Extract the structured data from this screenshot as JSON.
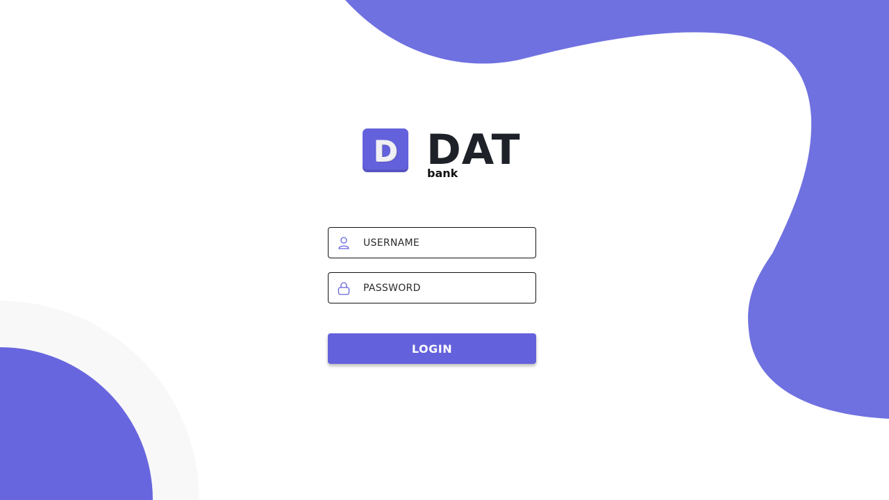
{
  "theme": {
    "accent": "#6461dc",
    "blob": "#6f71e0",
    "ring": "#f8f8f8",
    "text_dark": "#1f2128"
  },
  "logo": {
    "mark_letter": "D",
    "wordmark": "DAT",
    "subtitle": "bank"
  },
  "form": {
    "username": {
      "placeholder": "USERNAME",
      "value": "",
      "icon": "user-icon"
    },
    "password": {
      "placeholder": "PASSWORD",
      "value": "",
      "icon": "lock-icon"
    },
    "login_label": "LOGIN"
  }
}
